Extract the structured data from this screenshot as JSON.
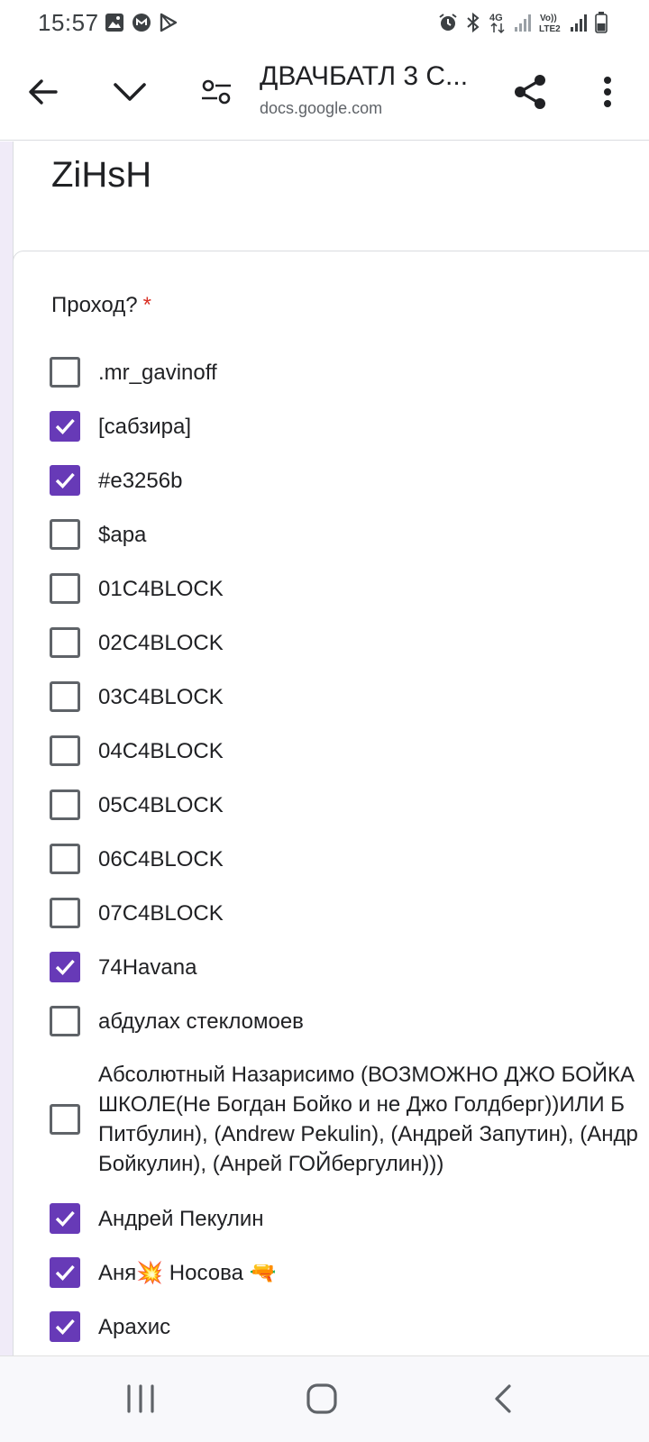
{
  "status_bar": {
    "time": "15:57",
    "left_icons": [
      "gallery-icon",
      "messenger-icon",
      "play-store-icon"
    ],
    "right_icons": [
      "alarm-icon",
      "bluetooth-icon",
      "4g-icon",
      "signal-icon",
      "volte-lte2-icon",
      "signal-icon",
      "battery-icon"
    ]
  },
  "browser": {
    "title": "ДВАЧБАТЛ 3 С...",
    "url": "docs.google.com"
  },
  "form": {
    "previous_answer": "ZiHsH",
    "question": "Проход?",
    "required_mark": "*",
    "accent_color": "#673ab7",
    "options": [
      {
        "label": ".mr_gavinoff",
        "checked": false
      },
      {
        "label": "[сабзира]",
        "checked": true
      },
      {
        "label": "#e3256b",
        "checked": true
      },
      {
        "label": "$apa",
        "checked": false
      },
      {
        "label": "01C4BLOCK",
        "checked": false
      },
      {
        "label": "02C4BLOCK",
        "checked": false
      },
      {
        "label": "03C4BLOCK",
        "checked": false
      },
      {
        "label": "04C4BLOCK",
        "checked": false
      },
      {
        "label": "05C4BLOCK",
        "checked": false
      },
      {
        "label": "06C4BLOCK",
        "checked": false
      },
      {
        "label": "07C4BLOCK",
        "checked": false
      },
      {
        "label": "74Havana",
        "checked": true
      },
      {
        "label": "абдулах стекломоев",
        "checked": false
      },
      {
        "label_lines": [
          "Абсолютный Назарисимо (ВОЗМОЖНО ДЖО БОЙКА",
          "ШКОЛЕ(Не Богдан Бойко и не Джо Голдберг))ИЛИ Б",
          "Питбулин), (Andrew Pekulin), (Андрей Запутин), (Андр",
          "Бойкулин), (Анрей ГОЙбергулин)))"
        ],
        "checked": false
      },
      {
        "label": "Андрей Пекулин",
        "checked": true
      },
      {
        "label": "Аня💥 Носова 🔫",
        "checked": true
      },
      {
        "label": "Арахис",
        "checked": true
      }
    ]
  },
  "nav_bar": {
    "buttons": [
      "recents-icon",
      "home-icon",
      "back-icon"
    ]
  }
}
